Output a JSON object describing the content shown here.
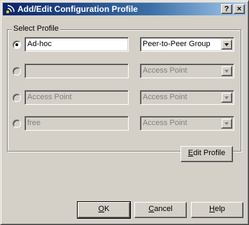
{
  "window": {
    "title": "Add/Edit Configuration Profile",
    "help_button": "?",
    "close_button": "×"
  },
  "group": {
    "label": "Select Profile"
  },
  "profiles": [
    {
      "name": "Ad-hoc",
      "mode": "Peer-to-Peer Group",
      "selected": true,
      "enabled": true
    },
    {
      "name": "",
      "mode": "Access Point",
      "selected": false,
      "enabled": false
    },
    {
      "name": "Access Point",
      "mode": "Access Point",
      "selected": false,
      "enabled": false
    },
    {
      "name": "free",
      "mode": "Access Point",
      "selected": false,
      "enabled": false
    }
  ],
  "buttons": {
    "edit_profile_first": "E",
    "edit_profile_rest": "dit Profile",
    "ok_first": "O",
    "ok_rest": "K",
    "cancel_first": "C",
    "cancel_rest": "ancel",
    "help_first": "H",
    "help_rest": "elp"
  }
}
